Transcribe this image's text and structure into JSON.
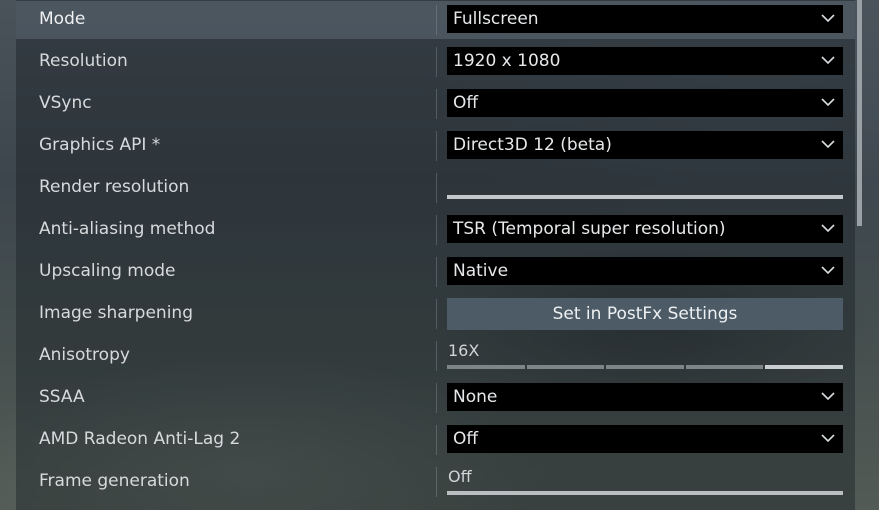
{
  "settings": [
    {
      "label": "Mode",
      "type": "dropdown",
      "value": "Fullscreen",
      "selected": true
    },
    {
      "label": "Resolution",
      "type": "dropdown",
      "value": "1920 x 1080"
    },
    {
      "label": "VSync",
      "type": "dropdown",
      "value": "Off"
    },
    {
      "label": "Graphics API *",
      "type": "dropdown",
      "value": "Direct3D 12 (beta)"
    },
    {
      "label": "Render resolution",
      "type": "slider",
      "value": ""
    },
    {
      "label": "Anti-aliasing method",
      "type": "dropdown",
      "value": "TSR (Temporal super resolution)"
    },
    {
      "label": "Upscaling mode",
      "type": "dropdown",
      "value": "Native"
    },
    {
      "label": "Image sharpening",
      "type": "button",
      "value": "Set in PostFx Settings"
    },
    {
      "label": "Anisotropy",
      "type": "segmented-slider",
      "value": "16X",
      "segments": 5,
      "active_segment": 5
    },
    {
      "label": "SSAA",
      "type": "dropdown",
      "value": "None"
    },
    {
      "label": "AMD Radeon Anti-Lag 2",
      "type": "dropdown",
      "value": "Off"
    },
    {
      "label": "Frame generation",
      "type": "slider",
      "value": "Off"
    }
  ],
  "icons": {
    "dropdown_arrow": "chevron-down-icon"
  }
}
